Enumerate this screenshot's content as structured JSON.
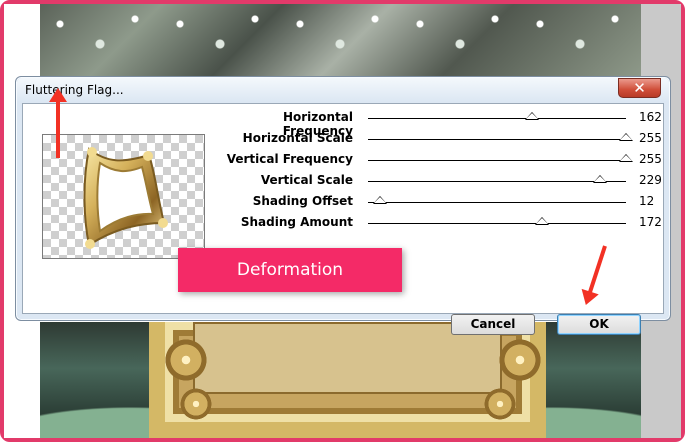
{
  "dialog": {
    "title": "Fluttering Flag..."
  },
  "parameters": [
    {
      "label": "Horizontal Frequency",
      "value": "162",
      "level": 0.635
    },
    {
      "label": "Horizontal Scale",
      "value": "255",
      "level": 1.0
    },
    {
      "label": "Vertical Frequency",
      "value": "255",
      "level": 1.0
    },
    {
      "label": "Vertical Scale",
      "value": "229",
      "level": 0.898
    },
    {
      "label": "Shading Offset",
      "value": "12",
      "level": 0.047
    },
    {
      "label": "Shading Amount",
      "value": "172",
      "level": 0.675
    }
  ],
  "buttons": {
    "cancel": "Cancel",
    "ok": "OK",
    "close": "✕"
  },
  "callout": {
    "text": "Deformation"
  },
  "colors": {
    "accent_pink": "#f42a67",
    "arrow_red": "#f23124",
    "window_blue": "#dce7f3",
    "close_red": "#cf4d38"
  },
  "icons": {
    "close": "close-icon",
    "up_arrow": "red-up-arrow",
    "down_arrow": "red-down-arrow"
  }
}
